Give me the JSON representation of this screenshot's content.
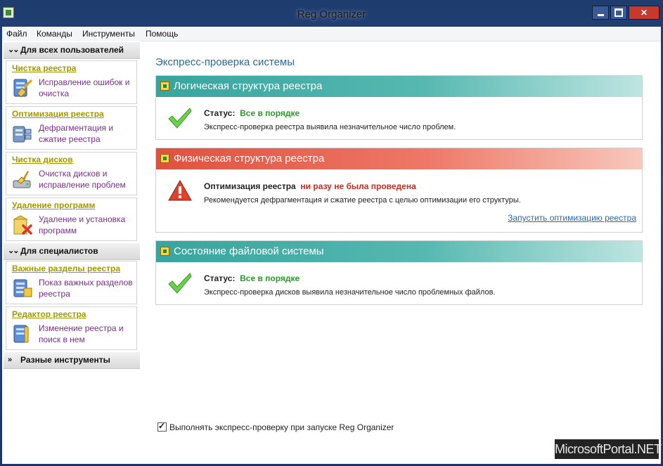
{
  "window": {
    "title": "Reg Organizer"
  },
  "menu": [
    "Файл",
    "Команды",
    "Инструменты",
    "Помощь"
  ],
  "sidebar": {
    "all_users": {
      "label": "Для всех пользователей",
      "items": [
        {
          "title": "Чистка реестра",
          "desc": "Исправление ошибок и очистка",
          "icon": "registry-cleaner-icon"
        },
        {
          "title": "Оптимизация реестра",
          "desc": "Дефрагментация и сжатие реестра",
          "icon": "registry-optimizer-icon"
        },
        {
          "title": "Чистка дисков",
          "desc": "Очистка дисков и исправление проблем",
          "icon": "disk-cleaner-icon"
        },
        {
          "title": "Удаление программ",
          "desc": "Удаление и установка программ",
          "icon": "uninstaller-icon"
        }
      ]
    },
    "specialists": {
      "label": "Для специалистов",
      "items": [
        {
          "title": "Важные разделы реестра",
          "desc": "Показ важных разделов реестра",
          "icon": "important-keys-icon"
        },
        {
          "title": "Редактор реестра",
          "desc": "Изменение реестра и поиск в нем",
          "icon": "registry-editor-icon"
        }
      ]
    },
    "misc": {
      "label": "Разные инструменты"
    }
  },
  "main": {
    "title": "Экспресс-проверка системы",
    "panels": [
      {
        "header": "Логическая структура реестра",
        "status_label": "Статус:",
        "status_value": "Все в порядке",
        "message": "Экспресс-проверка реестра выявила незначительное число проблем.",
        "state": "ok"
      },
      {
        "header": "Физическая структура реестра",
        "status_label": "Оптимизация реестра",
        "status_value": "ни разу не была проведена",
        "message": "Рекомендуется дефрагментация и сжатие реестра с целью оптимизации его структуры.",
        "link": "Запустить оптимизацию реестра",
        "state": "warning"
      },
      {
        "header": "Состояние файловой системы",
        "status_label": "Статус:",
        "status_value": "Все в порядке",
        "message": "Экспресс-проверка дисков выявила незначительное число проблемных файлов.",
        "state": "ok"
      }
    ],
    "startup_checkbox": {
      "label": "Выполнять экспресс-проверку при запуске Reg Organizer",
      "checked": true
    }
  },
  "watermark": "MicrosoftPortal.NET",
  "colors": {
    "ok": "#2b9a2b",
    "warning": "#d0261b",
    "link": "#2a67b5",
    "card_title": "#a09a00",
    "card_desc": "#7a2e8c"
  }
}
